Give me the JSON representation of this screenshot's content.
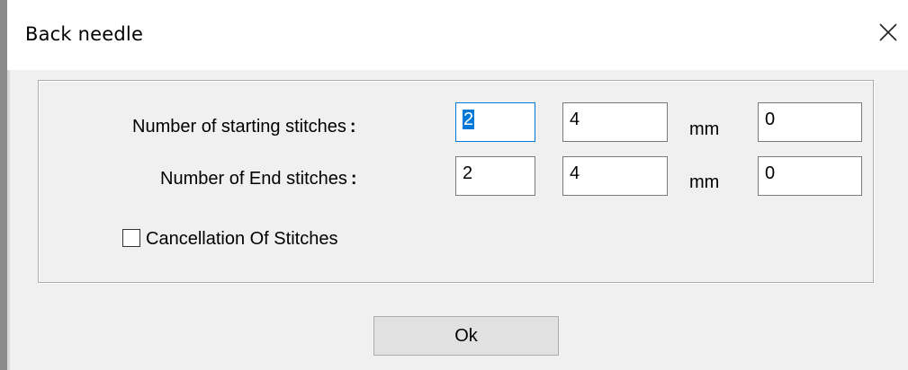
{
  "window": {
    "title": "Back needle",
    "close_icon": "close-icon"
  },
  "rows": [
    {
      "label": "Number of starting stitches",
      "colon": ":",
      "value1": "2",
      "value2": "4",
      "unit": "mm",
      "value3": "0"
    },
    {
      "label": "Number of End stitches",
      "colon": ":",
      "value1": "2",
      "value2": "4",
      "unit": "mm",
      "value3": "0"
    }
  ],
  "cancellation": {
    "label": "Cancellation Of Stitches",
    "checked": false
  },
  "ok_button": {
    "label": "Ok"
  },
  "colors": {
    "selection": "#0078d7",
    "dialog_bg": "#f0f0f0",
    "button_bg": "#e1e1e1"
  }
}
